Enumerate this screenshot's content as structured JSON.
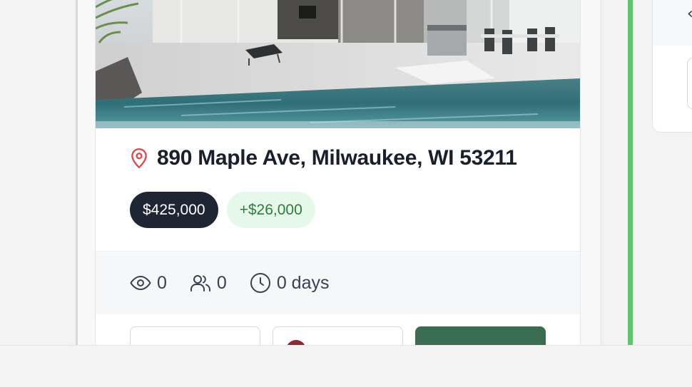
{
  "listing": {
    "address": "890 Maple Ave, Milwaukee, WI 53211",
    "price": "$425,000",
    "price_change": "+$26,000",
    "stats": {
      "views": "0",
      "leads": "0",
      "days_on_market": "0 days"
    }
  },
  "icons": {
    "location": "map-pin-icon",
    "views": "eye-icon",
    "leads": "users-icon",
    "days": "clock-icon"
  },
  "colors": {
    "price_badge_bg": "#1e2533",
    "delta_badge_bg": "#e6f8ea",
    "delta_badge_text": "#2f7d3d",
    "pin": "#e04a4a",
    "primary_button": "#3b6b50",
    "status_bar": "#5fc46d"
  },
  "right_panel": {
    "chevron": "‹"
  }
}
